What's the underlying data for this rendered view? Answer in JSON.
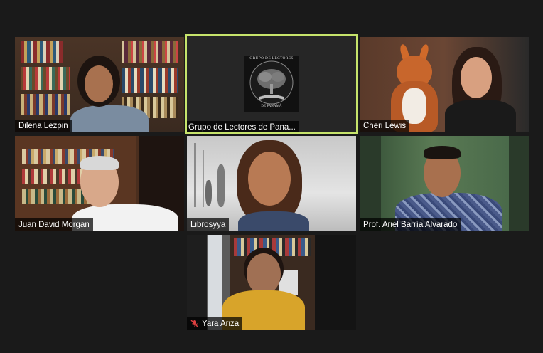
{
  "participants": [
    {
      "name": "Dilena Lezpin",
      "muted": false
    },
    {
      "name": "Grupo de Lectores de Pana...",
      "muted": false,
      "active": true
    },
    {
      "name": "Cheri Lewis",
      "muted": false
    },
    {
      "name": "Juan David Morgan",
      "muted": false
    },
    {
      "name": "Librosyya",
      "muted": false
    },
    {
      "name": "Prof. Ariel Barría Alvarado",
      "muted": false
    },
    {
      "name": "Yara Ariza",
      "muted": true
    }
  ],
  "logo": {
    "top_text": "GRUPO DE LECTORES",
    "bottom_text": "DE PANAMÁ"
  },
  "colors": {
    "background": "#1a1a1a",
    "active_speaker_border": "#c6e36b",
    "mute_icon": "#e04040"
  }
}
